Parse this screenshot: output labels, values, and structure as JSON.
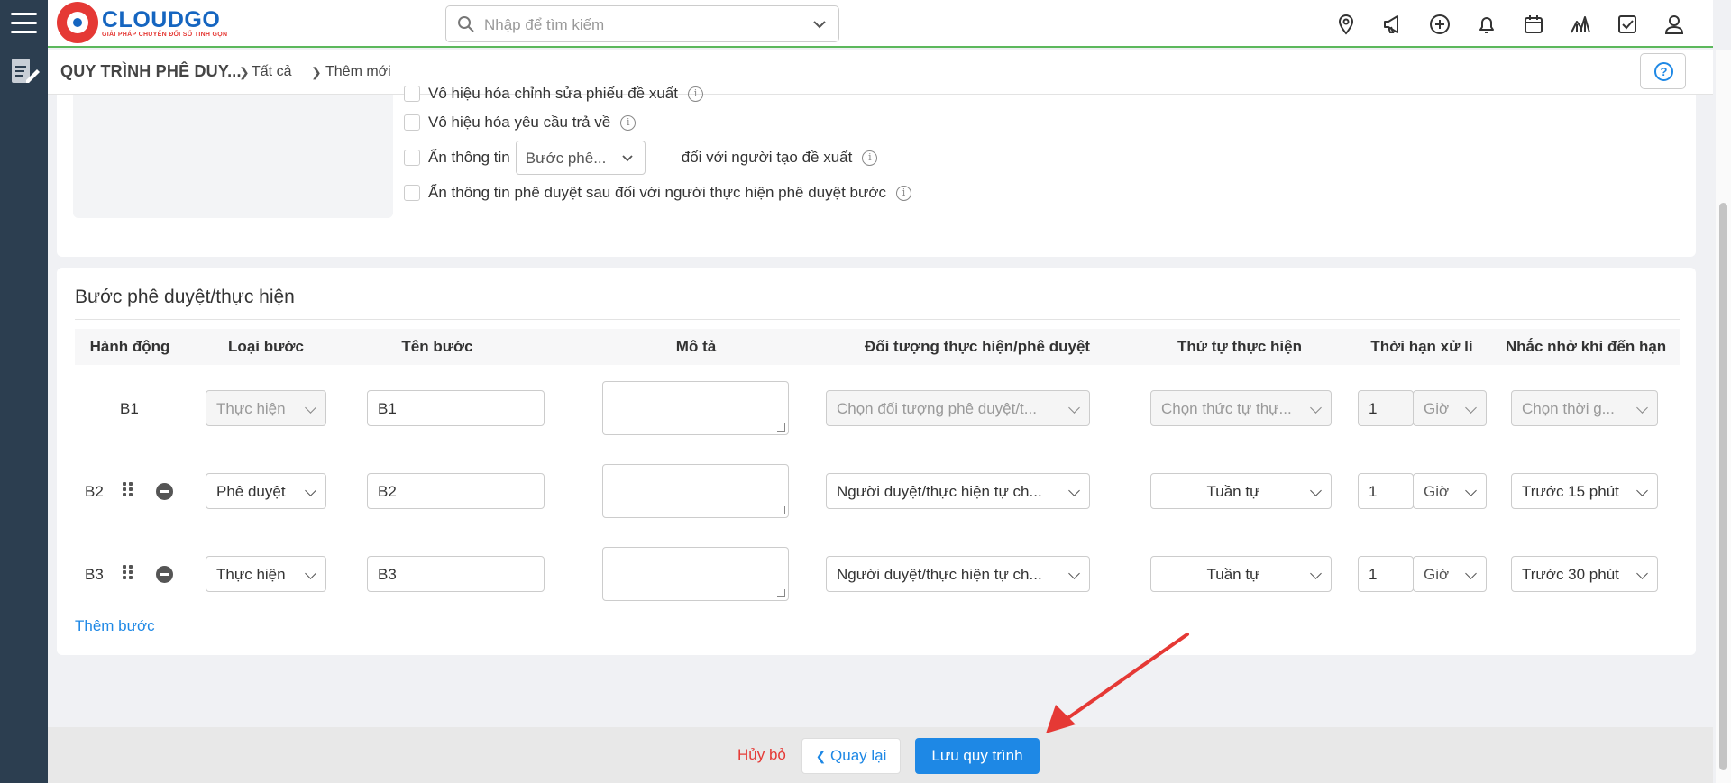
{
  "app": {
    "brand": "CLOUDGO",
    "tagline": "GIẢI PHÁP CHUYỂN ĐỔI SỐ TINH GỌN",
    "search_placeholder": "Nhập để tìm kiếm",
    "header_icons": [
      "location-icon",
      "megaphone-icon",
      "plus-circle-icon",
      "bell-icon",
      "calendar-icon",
      "chart-icon",
      "checkbox-icon",
      "user-icon"
    ]
  },
  "breadcrumb": {
    "title": "QUY TRÌNH PHÊ DUY...",
    "item1": "Tất cả",
    "item2": "Thêm mới"
  },
  "options": {
    "partial": "Vô hiệu hóa chỉnh sửa phiếu đề xuất",
    "disable_return": "Vô hiệu hóa yêu cầu trả về",
    "hide_info_prefix": "Ẩn thông tin",
    "hide_info_select": "Bước phê...",
    "hide_info_suffix": "đối với người tạo đề xuất",
    "hide_after": "Ẩn thông tin phê duyệt sau đối với người thực hiện phê duyệt bước"
  },
  "steps_section": {
    "title": "Bước phê duyệt/thực hiện",
    "columns": [
      "Hành động",
      "Loại bước",
      "Tên bước",
      "Mô tả",
      "Đối tượng thực hiện/phê duyệt",
      "Thứ tự thực hiện",
      "Thời hạn xử lí",
      "Nhắc nhở khi đến hạn"
    ],
    "rows": [
      {
        "label": "B1",
        "type": "Thực hiện",
        "name": "B1",
        "target": "Chọn đối tượng phê duyệt/t...",
        "order": "Chọn thức tự thự...",
        "deadline": "1",
        "unit": "Giờ",
        "remind": "Chọn thời g..."
      },
      {
        "label": "B2",
        "type": "Phê duyệt",
        "name": "B2",
        "target": "Người duyệt/thực hiện tự ch...",
        "order": "Tuần tự",
        "deadline": "1",
        "unit": "Giờ",
        "remind": "Trước 15 phút"
      },
      {
        "label": "B3",
        "type": "Thực hiện",
        "name": "B3",
        "target": "Người duyệt/thực hiện tự ch...",
        "order": "Tuần tự",
        "deadline": "1",
        "unit": "Giờ",
        "remind": "Trước 30 phút"
      }
    ],
    "add_step": "Thêm bước"
  },
  "footer": {
    "cancel": "Hủy bỏ",
    "back": "Quay lại",
    "save": "Lưu quy trình"
  },
  "colors": {
    "primary": "#1e88e5",
    "danger": "#e53935",
    "sidebar": "#2c3e50",
    "header_border": "#5cb85c"
  }
}
